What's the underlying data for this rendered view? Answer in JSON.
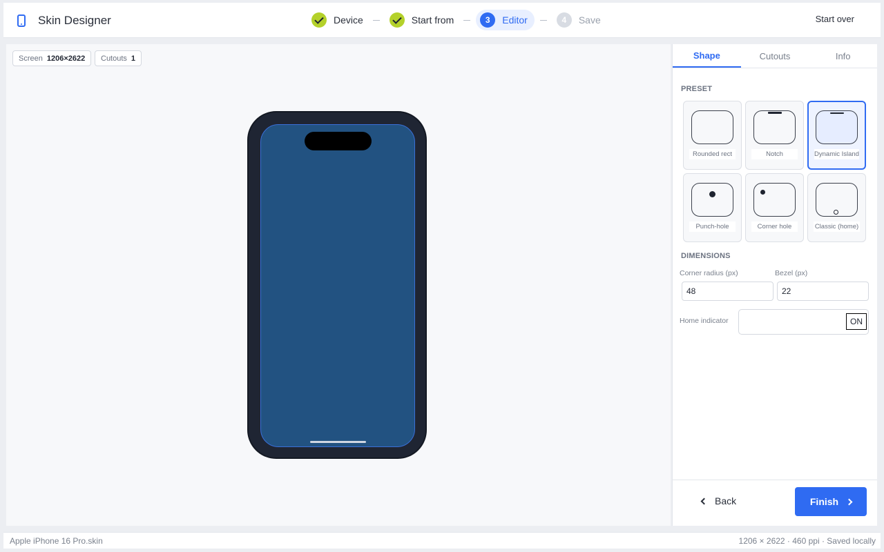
{
  "app": {
    "title": "Skin Designer"
  },
  "steps": [
    {
      "label": "Device",
      "state": "done"
    },
    {
      "label": "Start from",
      "state": "done"
    },
    {
      "number": "3",
      "label": "Editor",
      "state": "active"
    },
    {
      "number": "4",
      "label": "Save",
      "state": "pending"
    }
  ],
  "header": {
    "start_over": "Start over"
  },
  "canvas": {
    "screen_chip": {
      "label": "Screen",
      "value": "1206×2622"
    },
    "cutouts_chip": {
      "label": "Cutouts",
      "value": "1"
    }
  },
  "tabs": [
    {
      "label": "Shape",
      "active": true
    },
    {
      "label": "Cutouts",
      "active": false
    },
    {
      "label": "Info",
      "active": false
    }
  ],
  "preset": {
    "title": "PRESET",
    "items": [
      {
        "label": "Rounded rect",
        "selected": false
      },
      {
        "label": "Notch",
        "selected": false
      },
      {
        "label": "Dynamic Island",
        "selected": true
      },
      {
        "label": "Punch-hole",
        "selected": false
      },
      {
        "label": "Corner hole",
        "selected": false
      },
      {
        "label": "Classic (home)",
        "selected": false
      }
    ]
  },
  "dimensions": {
    "title": "DIMENSIONS",
    "corner_radius": {
      "label": "Corner radius (px)",
      "value": "48"
    },
    "bezel": {
      "label": "Bezel (px)",
      "value": "22"
    },
    "home_indicator": {
      "label": "Home indicator",
      "toggle": "ON"
    }
  },
  "footer": {
    "back": "Back",
    "finish": "Finish"
  },
  "status": {
    "file": "Apple iPhone 16 Pro.skin",
    "info": "1206 × 2622 · 460 ppi · Saved locally"
  },
  "colors": {
    "accent": "#2f6bf2",
    "done": "#b4d12a",
    "phone_body": "#1f2533",
    "phone_screen": "#225281"
  }
}
